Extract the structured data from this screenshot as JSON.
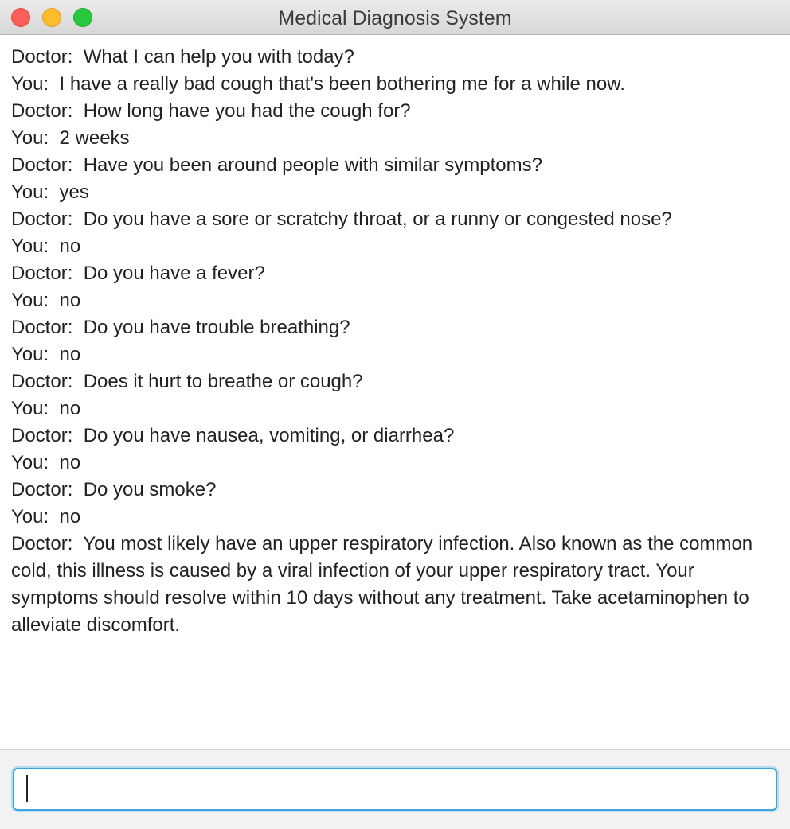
{
  "window": {
    "title": "Medical Diagnosis System"
  },
  "conversation": [
    {
      "speaker": "Doctor:",
      "text": "What I can help you with today?"
    },
    {
      "speaker": "You:",
      "text": "I have a really bad cough that's been bothering me for a while now."
    },
    {
      "speaker": "Doctor:",
      "text": "How long have you had the cough for?"
    },
    {
      "speaker": "You:",
      "text": "2 weeks"
    },
    {
      "speaker": "Doctor:",
      "text": "Have you been around people with similar symptoms?"
    },
    {
      "speaker": "You:",
      "text": "yes"
    },
    {
      "speaker": "Doctor:",
      "text": "Do you have a sore or scratchy throat, or a runny or congested nose?"
    },
    {
      "speaker": "You:",
      "text": "no"
    },
    {
      "speaker": "Doctor:",
      "text": "Do you have a fever?"
    },
    {
      "speaker": "You:",
      "text": "no"
    },
    {
      "speaker": "Doctor:",
      "text": "Do you have trouble breathing?"
    },
    {
      "speaker": "You:",
      "text": "no"
    },
    {
      "speaker": "Doctor:",
      "text": "Does it hurt to breathe or cough?"
    },
    {
      "speaker": "You:",
      "text": "no"
    },
    {
      "speaker": "Doctor:",
      "text": "Do you have nausea, vomiting, or diarrhea?"
    },
    {
      "speaker": "You:",
      "text": "no"
    },
    {
      "speaker": "Doctor:",
      "text": "Do you smoke?"
    },
    {
      "speaker": "You:",
      "text": "no"
    },
    {
      "speaker": "Doctor:",
      "text": "You most likely have an upper respiratory infection. Also known as the common cold, this illness is caused by a viral infection of your upper respiratory tract. Your symptoms should resolve within 10 days without any treatment. Take acetaminophen to alleviate discomfort."
    }
  ],
  "input": {
    "value": "",
    "placeholder": ""
  },
  "colors": {
    "close": "#fc5f57",
    "minimize": "#fdbb2e",
    "zoom": "#28c840",
    "focus_ring": "#3aa6dc"
  }
}
